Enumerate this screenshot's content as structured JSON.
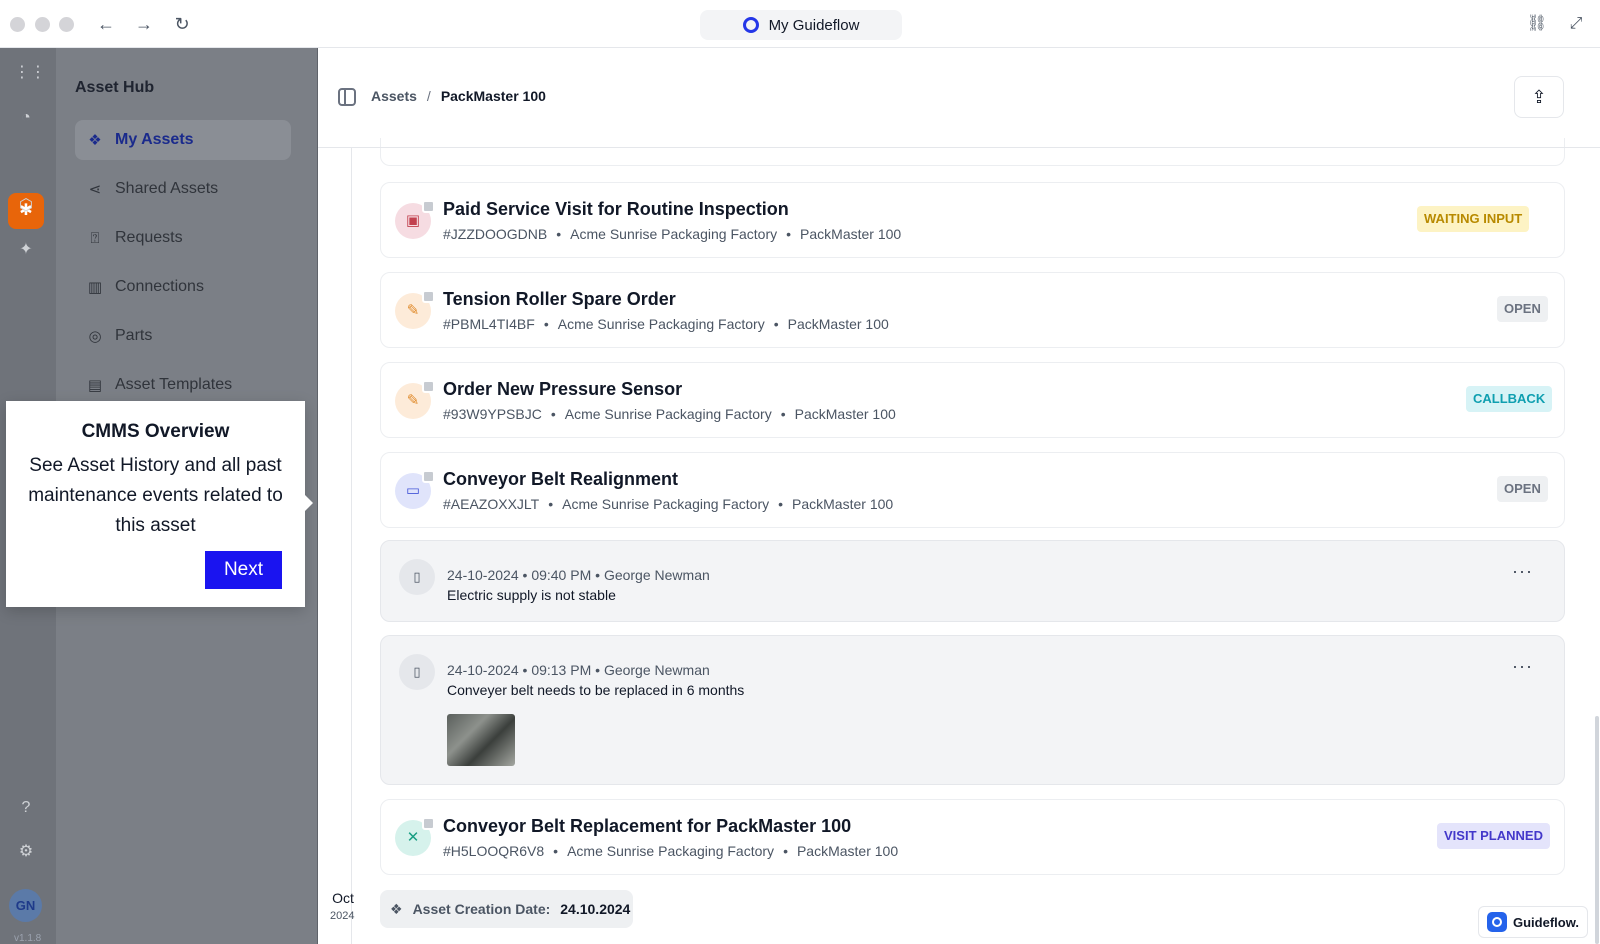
{
  "browser": {
    "title": "My Guideflow"
  },
  "sidebar": {
    "title": "Asset Hub",
    "items": [
      {
        "label": "My Assets",
        "icon": "my-assets-icon"
      },
      {
        "label": "Shared Assets",
        "icon": "share-icon"
      },
      {
        "label": "Requests",
        "icon": "question-icon"
      },
      {
        "label": "Connections",
        "icon": "building-icon"
      },
      {
        "label": "Parts",
        "icon": "parts-icon"
      },
      {
        "label": "Asset Templates",
        "icon": "template-icon"
      }
    ]
  },
  "rail": {
    "avatar": "GN",
    "version": "v1.1.8"
  },
  "breadcrumb": {
    "parent": "Assets",
    "separator": "/",
    "current": "PackMaster 100"
  },
  "tickets": [
    {
      "title": "Paid Service Visit for Routine Inspection",
      "id": "#JZZDOOGDNB",
      "site": "Acme Sunrise Packaging Factory",
      "asset": "PackMaster 100",
      "status": "WAITING INPUT",
      "status_color": "#b88a00",
      "status_bg": "#fdf3c4",
      "icon": "clipboard-icon",
      "icon_bg": "#f6dce2",
      "icon_color": "#c2414f"
    },
    {
      "title": "Tension Roller Spare Order",
      "id": "#PBML4TI4BF",
      "site": "Acme Sunrise Packaging Factory",
      "asset": "PackMaster 100",
      "status": "OPEN",
      "status_color": "#6b7280",
      "status_bg": "#eef0f2",
      "icon": "wrench-icon",
      "icon_bg": "#fdebd9",
      "icon_color": "#e08a2b"
    },
    {
      "title": "Order New Pressure Sensor",
      "id": "#93W9YPSBJC",
      "site": "Acme Sunrise Packaging Factory",
      "asset": "PackMaster 100",
      "status": "CALLBACK",
      "status_color": "#0f9fb0",
      "status_bg": "#d7f3f6",
      "icon": "wrench-icon",
      "icon_bg": "#fdebd9",
      "icon_color": "#e08a2b"
    },
    {
      "title": "Conveyor Belt Realignment",
      "id": "#AEAZOXXJLT",
      "site": "Acme Sunrise Packaging Factory",
      "asset": "PackMaster 100",
      "status": "OPEN",
      "status_color": "#6b7280",
      "status_bg": "#eef0f2",
      "icon": "folder-icon",
      "icon_bg": "#e0e4fb",
      "icon_color": "#4657d8"
    }
  ],
  "notes": [
    {
      "date": "24-10-2024",
      "time": "09:40 PM",
      "author": "George Newman",
      "text": "Electric supply is not stable"
    },
    {
      "date": "24-10-2024",
      "time": "09:13 PM",
      "author": "George Newman",
      "text": "Conveyer belt needs to be replaced in 6 months"
    }
  ],
  "final_ticket": {
    "title": "Conveyor Belt Replacement for PackMaster 100",
    "id": "#H5LOOQR6V8",
    "site": "Acme Sunrise Packaging Factory",
    "asset": "PackMaster 100",
    "status": "VISIT PLANNED",
    "status_color": "#4338ca",
    "status_bg": "#e4e4fb",
    "icon": "tools-icon",
    "icon_bg": "#d6f2ec",
    "icon_color": "#199e83"
  },
  "timeline": {
    "month": "Oct",
    "year": "2024"
  },
  "creation": {
    "label": "Asset Creation Date:",
    "value": "24.10.2024"
  },
  "tooltip": {
    "title": "CMMS Overview",
    "body": "See Asset History and all past maintenance events related to this asset",
    "next_label": "Next"
  },
  "watermark": {
    "label": "Guideflow."
  },
  "colors": {
    "accent": "#e8650a",
    "brand": "#1a14f0",
    "primary_text": "#111827"
  }
}
